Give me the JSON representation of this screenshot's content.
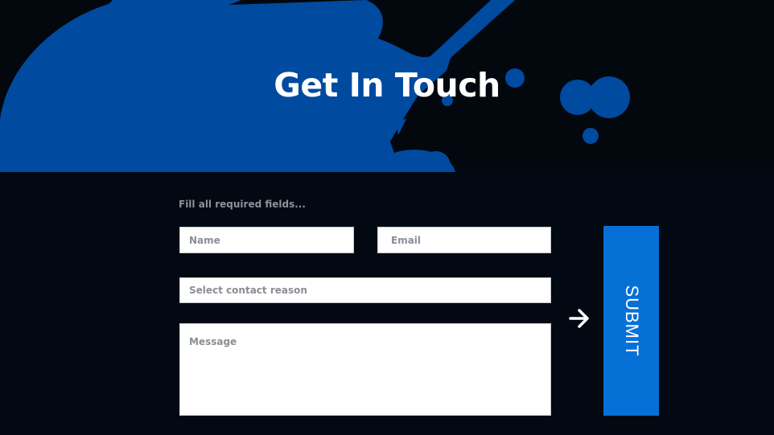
{
  "hero": {
    "title": "Get In Touch"
  },
  "form": {
    "helper_text": "Fill all required fields...",
    "name_placeholder": "Name",
    "email_placeholder": "Email",
    "reason_placeholder": "Select contact reason",
    "message_placeholder": "Message",
    "submit_label": "SUBMIT"
  },
  "colors": {
    "splash_blue": "#004a9f",
    "submit_blue": "#0670d7",
    "background": "#02060b"
  },
  "icons": {
    "arrow": "arrow-right-icon"
  }
}
